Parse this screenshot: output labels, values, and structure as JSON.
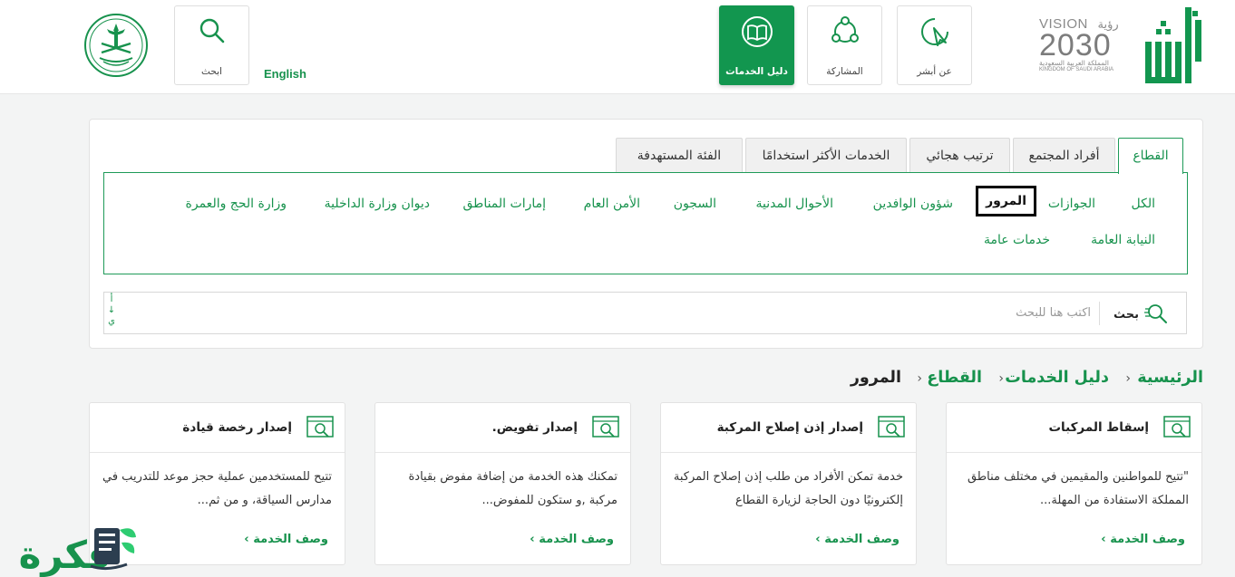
{
  "header": {
    "vision": {
      "line1_latin": "VISION",
      "line1_ar": "رؤية",
      "year": "2030",
      "kingdom_ar": "المملكة العربية السعودية",
      "kingdom_en": "KINGDOM OF SAUDI ARABIA"
    },
    "nav": {
      "about": "عن أبشر",
      "participation": "المشاركة",
      "services_guide": "دليل الخدمات"
    },
    "english": "English",
    "search": "ابحث"
  },
  "tabs": [
    "القطاع",
    "أفراد المجتمع",
    "ترتيب هجائي",
    "الخدمات الأكثر استخدامًا",
    "الفئة المستهدفة"
  ],
  "sectors_row1": [
    "الكل",
    "الجوازات",
    "المرور",
    "شؤون الوافدين",
    "الأحوال المدنية",
    "السجون",
    "الأمن العام",
    "إمارات المناطق",
    "ديوان وزارة الداخلية",
    "وزارة الحج والعمرة"
  ],
  "sectors_row2": [
    "النيابة العامة",
    "خدمات عامة"
  ],
  "search": {
    "label": "بحث",
    "placeholder": "اكتب هنا للبحث",
    "alpha_top": "أ",
    "alpha_arrow": "↓",
    "alpha_bottom": "ي"
  },
  "breadcrumb": [
    "الرئيسية",
    "دليل الخدمات",
    "القطاع",
    "المرور"
  ],
  "services": [
    {
      "title": "إسقاط المركبات",
      "desc": "\"تتيح للمواطنين والمقيمين في مختلف مناطق المملكة الاستفادة من المهلة...",
      "more": "وصف الخدمة"
    },
    {
      "title": "إصدار إذن إصلاح المركبة",
      "desc": "خدمة تمكن الأفراد من طلب إذن إصلاح المركبة إلكترونيًا دون الحاجة لزيارة القطاع",
      "more": "وصف الخدمة"
    },
    {
      "title": "إصدار تفويض.",
      "desc": "تمكنك هذه الخدمة من إضافة مفوض بقيادة مركبة ,و ستكون للمفوض...",
      "more": "وصف الخدمة"
    },
    {
      "title": "إصدار رخصة قيادة",
      "desc": "تتيح للمستخدمين عملية حجز موعد للتدريب في مدارس السياقة، و من ثم...",
      "more": "وصف الخدمة"
    }
  ],
  "watermark": "فكرة",
  "colors": {
    "primary": "#12964f",
    "link": "#17924d",
    "selected_border": "#000000"
  }
}
